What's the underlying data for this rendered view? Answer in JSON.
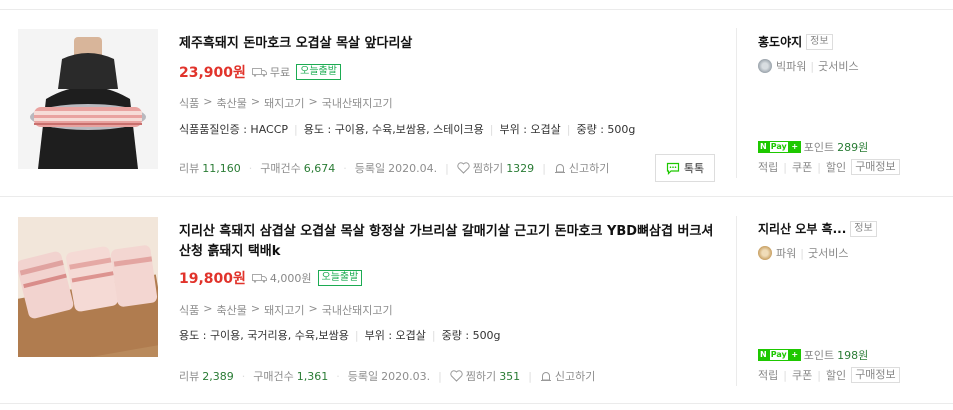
{
  "items": [
    {
      "title": "제주흑돼지 돈마호크 오겹살 목살 앞다리살",
      "price": "23,900원",
      "shipping": "무료",
      "badge": "오늘출발",
      "category": [
        "식품",
        ">",
        "축산물",
        ">",
        "돼지고기",
        ">",
        "국내산돼지고기"
      ],
      "specs": [
        "식품품질인증 : HACCP",
        "용도 : 구이용, 수육,보쌈용, 스테이크용",
        "부위 : 오겹살",
        "중량 : 500g"
      ],
      "review_label": "리뷰",
      "review_count": "11,160",
      "purchase_label": "구매건수",
      "purchase_count": "6,674",
      "reg_label": "등록일",
      "reg_date": "2020.04.",
      "zzim_label": "찜하기",
      "zzim_count": "1329",
      "report_label": "신고하기",
      "talk_label": "톡톡",
      "mall_name": "홍도야지",
      "info_tag": "정보",
      "grade": "빅파워",
      "service": "굿서비스",
      "point_label": "포인트",
      "point_value": "289원",
      "links": [
        "적립",
        "쿠폰",
        "할인"
      ],
      "purchase_info": "구매정보",
      "medal_color": "#9aa3ab"
    },
    {
      "title": "지리산 흑돼지 삼겹살 오겹살 목살 항정살 가브리살 갈매기살 근고기 돈마호크 YBD뼈삼겹 버크셔 산청 흙돼지 택배k",
      "price": "19,800원",
      "shipping": "4,000원",
      "badge": "오늘출발",
      "category": [
        "식품",
        ">",
        "축산물",
        ">",
        "돼지고기",
        ">",
        "국내산돼지고기"
      ],
      "specs": [
        "용도 : 구이용, 국거리용, 수육,보쌈용",
        "부위 : 오겹살",
        "중량 : 500g"
      ],
      "review_label": "리뷰",
      "review_count": "2,389",
      "purchase_label": "구매건수",
      "purchase_count": "1,361",
      "reg_label": "등록일",
      "reg_date": "2020.03.",
      "zzim_label": "찜하기",
      "zzim_count": "351",
      "report_label": "신고하기",
      "mall_name": "지리산 오부 흑...",
      "info_tag": "정보",
      "grade": "파워",
      "service": "굿서비스",
      "point_label": "포인트",
      "point_value": "198원",
      "links": [
        "적립",
        "쿠폰",
        "할인"
      ],
      "purchase_info": "구매정보",
      "medal_color": "#c8a063"
    }
  ],
  "colors": {
    "price": "#e1332b",
    "green": "#2a7c35",
    "npay": "#1ec800"
  },
  "npay": {
    "n": "N",
    "pay": "Pay",
    "plus": "+"
  }
}
